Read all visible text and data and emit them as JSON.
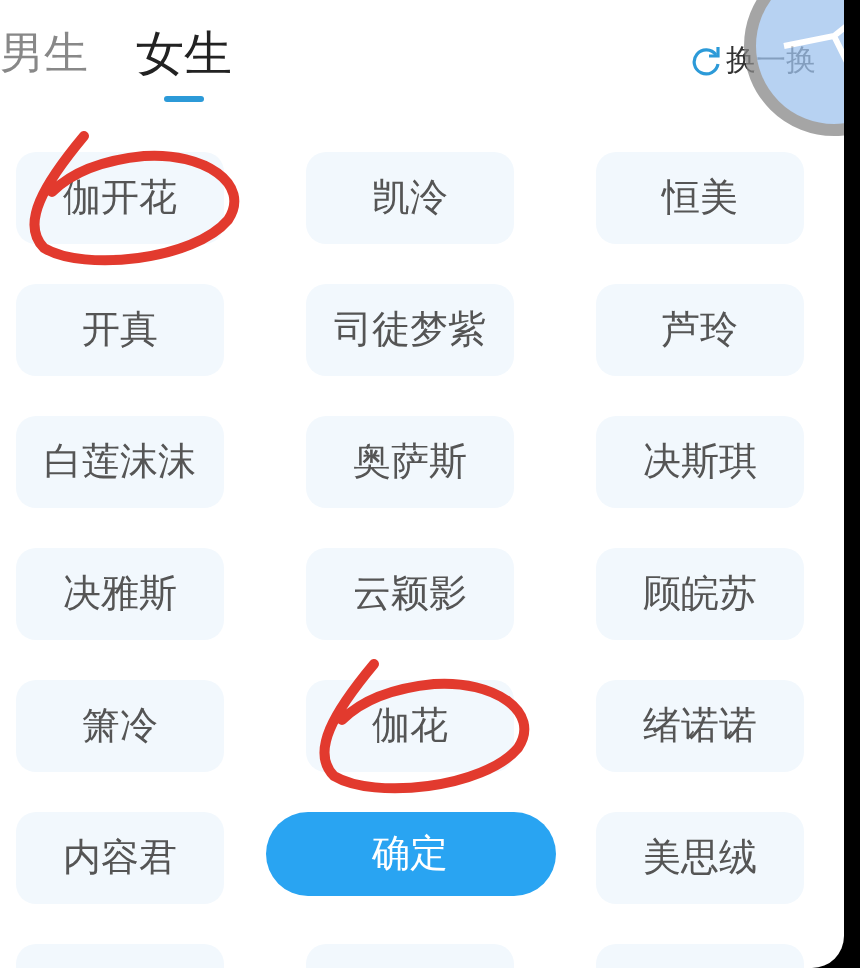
{
  "tabs": [
    {
      "label": "男生",
      "selected": false
    },
    {
      "label": "女生",
      "selected": true
    }
  ],
  "refresh": {
    "label": "换一换"
  },
  "names": [
    {
      "label": "伽开花",
      "circled": true
    },
    {
      "label": "凯泠",
      "circled": false
    },
    {
      "label": "恒美",
      "circled": false
    },
    {
      "label": "开真",
      "circled": false
    },
    {
      "label": "司徒梦紫",
      "circled": false
    },
    {
      "label": "芦玲",
      "circled": false
    },
    {
      "label": "白莲沫沫",
      "circled": false
    },
    {
      "label": "奥萨斯",
      "circled": false
    },
    {
      "label": "决斯琪",
      "circled": false
    },
    {
      "label": "决雅斯",
      "circled": false
    },
    {
      "label": "云颖影",
      "circled": false
    },
    {
      "label": "顾皖苏",
      "circled": false
    },
    {
      "label": "箫冷",
      "circled": false
    },
    {
      "label": "伽花",
      "circled": true
    },
    {
      "label": "绪诺诺",
      "circled": false
    },
    {
      "label": "内容君",
      "circled": false
    },
    {
      "label": "美思绒",
      "circled": false
    }
  ],
  "confirm": {
    "label": "确定"
  }
}
